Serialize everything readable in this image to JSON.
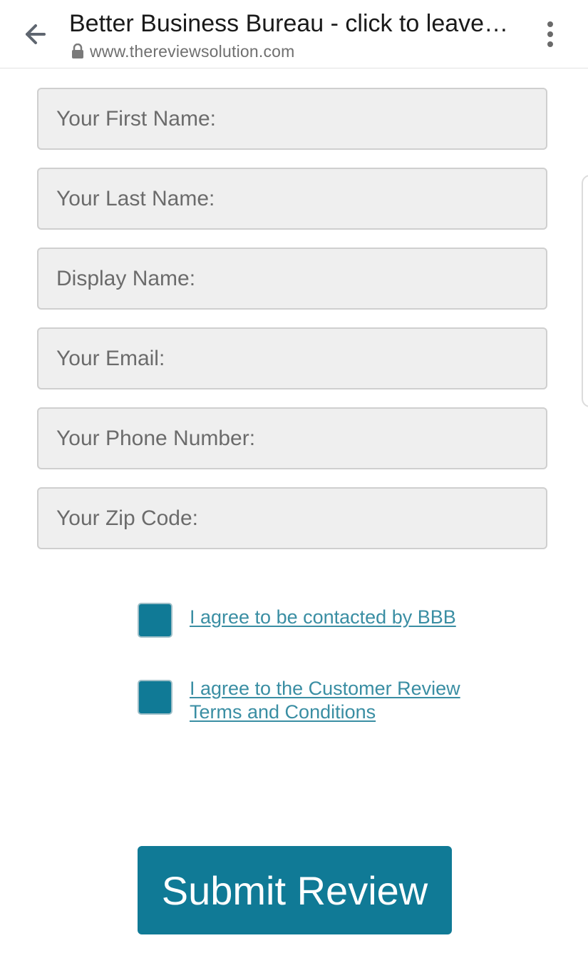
{
  "browser": {
    "title": "Better Business Bureau - click to leave a review",
    "url": "www.thereviewsolution.com"
  },
  "form": {
    "fields": [
      {
        "placeholder": "Your First Name:",
        "value": ""
      },
      {
        "placeholder": "Your Last Name:",
        "value": ""
      },
      {
        "placeholder": "Display Name:",
        "value": ""
      },
      {
        "placeholder": "Your Email:",
        "value": ""
      },
      {
        "placeholder": "Your Phone Number:",
        "value": ""
      },
      {
        "placeholder": "Your Zip Code:",
        "value": ""
      }
    ],
    "agreements": [
      {
        "label": "I agree to be contacted by BBB"
      },
      {
        "label": "I agree to the Customer Review Terms and Conditions"
      }
    ],
    "submit_label": "Submit Review"
  },
  "colors": {
    "accent": "#107a96",
    "link": "#3a8ea3",
    "field_bg": "#efefef"
  },
  "icons": {
    "back": "arrow-left-icon",
    "lock": "lock-icon",
    "menu": "more-vertical-icon"
  }
}
